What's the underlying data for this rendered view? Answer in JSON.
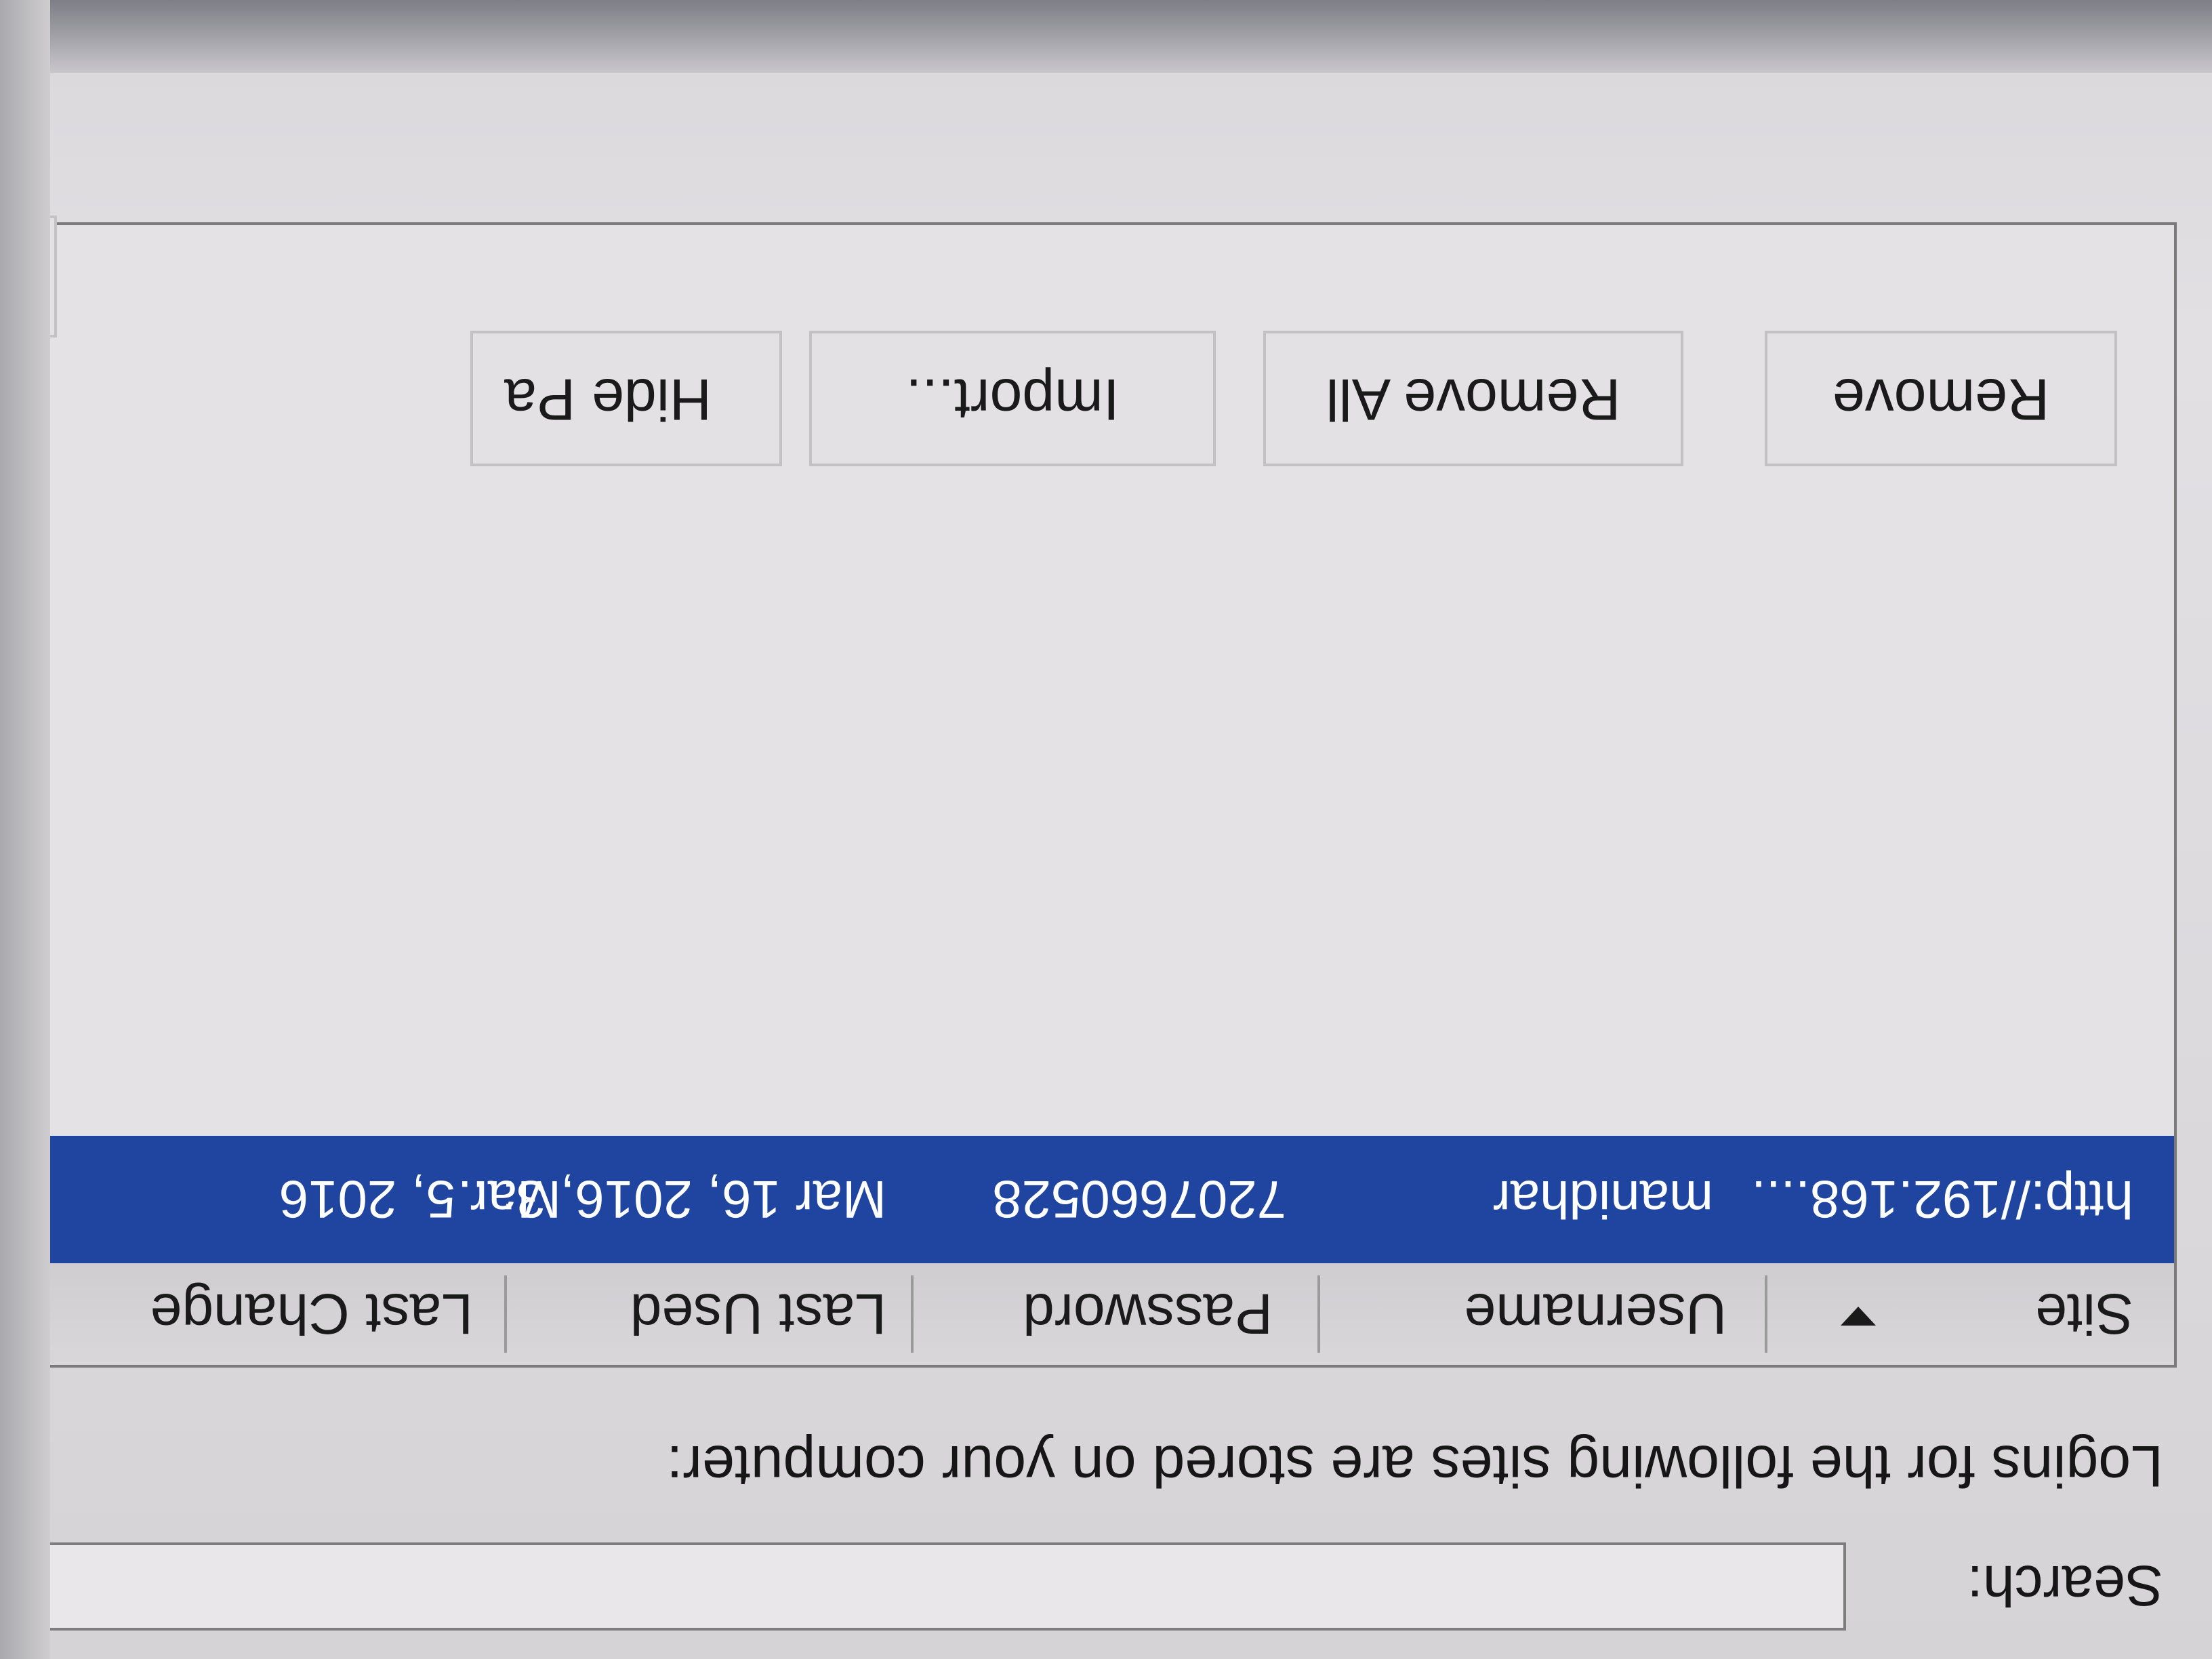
{
  "search": {
    "label": "Search:",
    "value": "",
    "placeholder": ""
  },
  "logins_label": "Logins for the following sites are stored on your computer:",
  "table": {
    "columns": [
      "Site",
      "Username",
      "Password",
      "Last Used",
      "Last Change"
    ],
    "rows": [
      {
        "site": "http://192.168....",
        "username": "manidhar",
        "password": "7207660528",
        "last_used": "Mar 16, 2016, 3:...",
        "last_changed": "Mar 5, 2016"
      }
    ]
  },
  "buttons": {
    "remove": "Remove",
    "remove_all": "Remove All",
    "import": "Import...",
    "hide_passwords": "Hide Pa"
  },
  "colors": {
    "selection": "#1f45a0",
    "background": "#dcdadd"
  }
}
